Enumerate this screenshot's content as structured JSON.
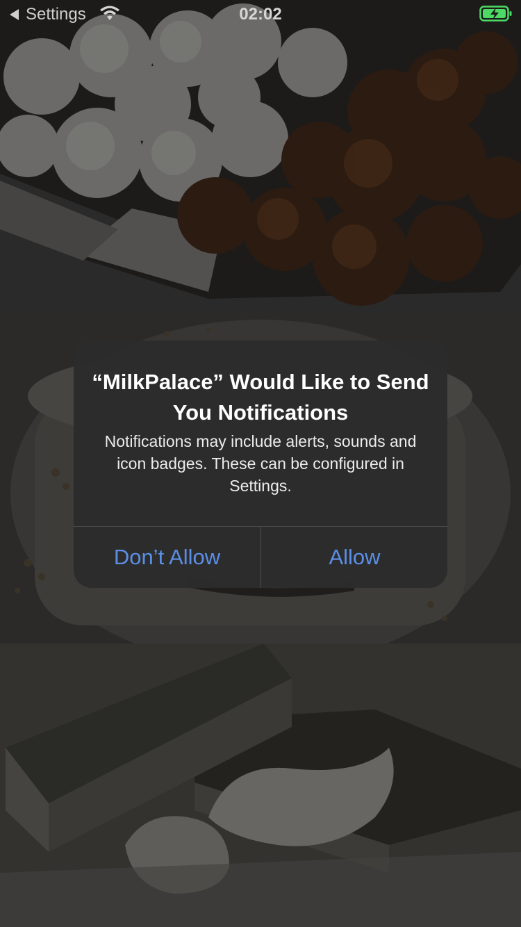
{
  "status_bar": {
    "back_label": "Settings",
    "time": "02:02",
    "icons": [
      "back-arrow-icon",
      "wifi-icon",
      "battery-charging-icon"
    ],
    "battery_color": "#4cd964"
  },
  "alert": {
    "title": "“MilkPalace” Would Like to Send You Notifications",
    "message": "Notifications may include alerts, sounds and icon badges. These can be configured in Settings.",
    "buttons": {
      "dont_allow": "Don’t Allow",
      "allow": "Allow"
    },
    "button_color": "#5b8fe6"
  },
  "background": {
    "photos": [
      "sweets-rasgulla-gulab-jamun-photo",
      "sweets-cup-dessert-photo",
      "sweets-kaju-burfi-photo"
    ]
  }
}
